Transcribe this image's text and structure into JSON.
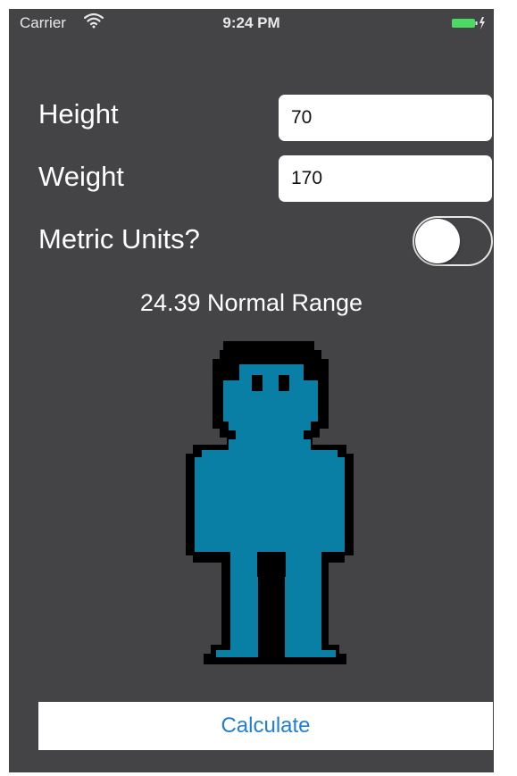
{
  "status_bar": {
    "carrier": "Carrier",
    "time": "9:24 PM"
  },
  "form": {
    "height_label": "Height",
    "height_value": "70",
    "weight_label": "Weight",
    "weight_value": "170",
    "metric_label": "Metric Units?",
    "metric_enabled": false
  },
  "result": {
    "text": "24.39 Normal Range"
  },
  "figure": {
    "icon": "pixel-person-icon",
    "body_color": "#0a7fa6",
    "outline_color": "#000000"
  },
  "actions": {
    "calculate_label": "Calculate"
  },
  "colors": {
    "background": "#444446",
    "button_text": "#1f7fd6",
    "battery": "#4cd964"
  }
}
